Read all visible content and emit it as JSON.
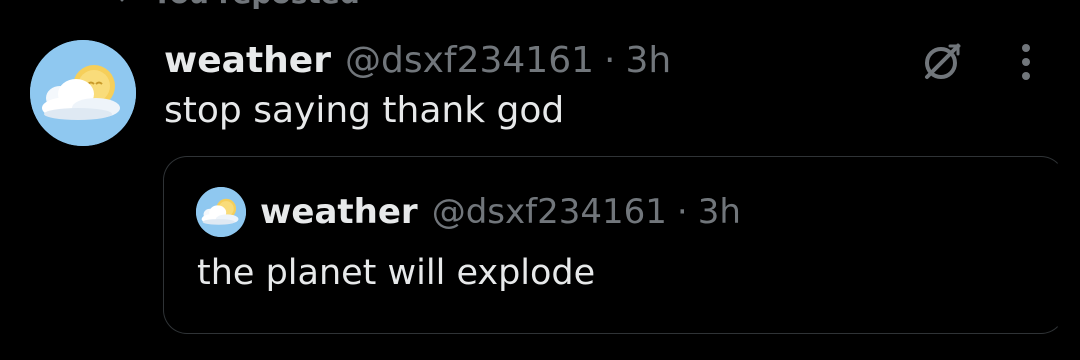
{
  "repost": {
    "label": "You reposted"
  },
  "tweet": {
    "author_name": "weather",
    "handle": "@dsxf234161",
    "separator": "·",
    "time": "3h",
    "text": "stop saying thank god",
    "avatar_icon": "sun-cloud-icon",
    "action_icons": [
      "grok-icon",
      "more-vertical-icon"
    ]
  },
  "quote": {
    "author_name": "weather",
    "handle": "@dsxf234161",
    "separator": "·",
    "time": "3h",
    "text": "the planet will explode",
    "avatar_icon": "sun-cloud-icon"
  },
  "colors": {
    "background": "#000000",
    "primary_text": "#e7e9ea",
    "secondary_text": "#71767b",
    "border": "#2f3336",
    "avatar_bg": "#8fc8f0"
  }
}
